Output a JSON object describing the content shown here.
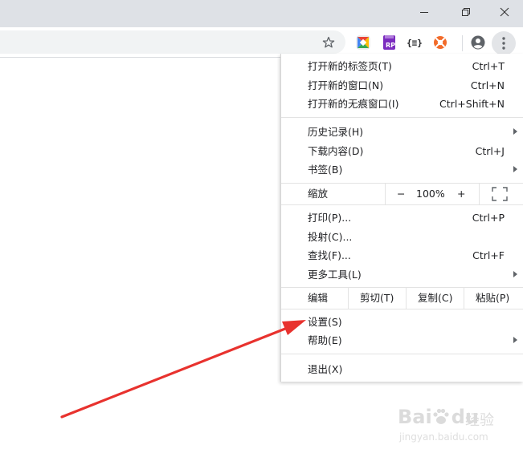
{
  "window_controls": {
    "minimize_icon": "minimize-icon",
    "restore_icon": "restore-icon",
    "close_icon": "close-icon"
  },
  "toolbar": {
    "bookmark_icon": "star-icon",
    "extensions": [
      {
        "name": "colorful-square-extension-icon"
      },
      {
        "name": "rp-extension-icon",
        "text": "RP"
      },
      {
        "name": "json-extension-icon",
        "text": "{≡}"
      },
      {
        "name": "orange-circle-extension-icon"
      }
    ],
    "profile_icon": "account-icon",
    "menu_icon": "more-vertical-icon"
  },
  "menu": {
    "group1": [
      {
        "label": "打开新的标签页(T)",
        "shortcut": "Ctrl+T"
      },
      {
        "label": "打开新的窗口(N)",
        "shortcut": "Ctrl+N"
      },
      {
        "label": "打开新的无痕窗口(I)",
        "shortcut": "Ctrl+Shift+N"
      }
    ],
    "group2": [
      {
        "label": "历史记录(H)",
        "shortcut": "",
        "submenu": true
      },
      {
        "label": "下载内容(D)",
        "shortcut": "Ctrl+J",
        "submenu": false
      },
      {
        "label": "书签(B)",
        "shortcut": "",
        "submenu": true
      }
    ],
    "zoom": {
      "label": "缩放",
      "minus": "−",
      "value": "100%",
      "plus": "+",
      "fullscreen_icon": "fullscreen-icon"
    },
    "group3": [
      {
        "label": "打印(P)...",
        "shortcut": "Ctrl+P",
        "submenu": false
      },
      {
        "label": "投射(C)...",
        "shortcut": "",
        "submenu": false
      },
      {
        "label": "查找(F)...",
        "shortcut": "Ctrl+F",
        "submenu": false
      },
      {
        "label": "更多工具(L)",
        "shortcut": "",
        "submenu": true
      }
    ],
    "edit": {
      "label": "编辑",
      "cut": "剪切(T)",
      "copy": "复制(C)",
      "paste": "粘贴(P)"
    },
    "group4": [
      {
        "label": "设置(S)",
        "shortcut": "",
        "submenu": false
      },
      {
        "label": "帮助(E)",
        "shortcut": "",
        "submenu": true
      }
    ],
    "exit": {
      "label": "退出(X)"
    }
  },
  "watermark": {
    "logo": "Bai",
    "logo2": "du",
    "text": "经验",
    "url": "jingyan.baidu.com"
  },
  "colors": {
    "accent_arrow": "#e8322e",
    "titlebar": "#dee1e6",
    "omnibox": "#f1f3f4"
  }
}
